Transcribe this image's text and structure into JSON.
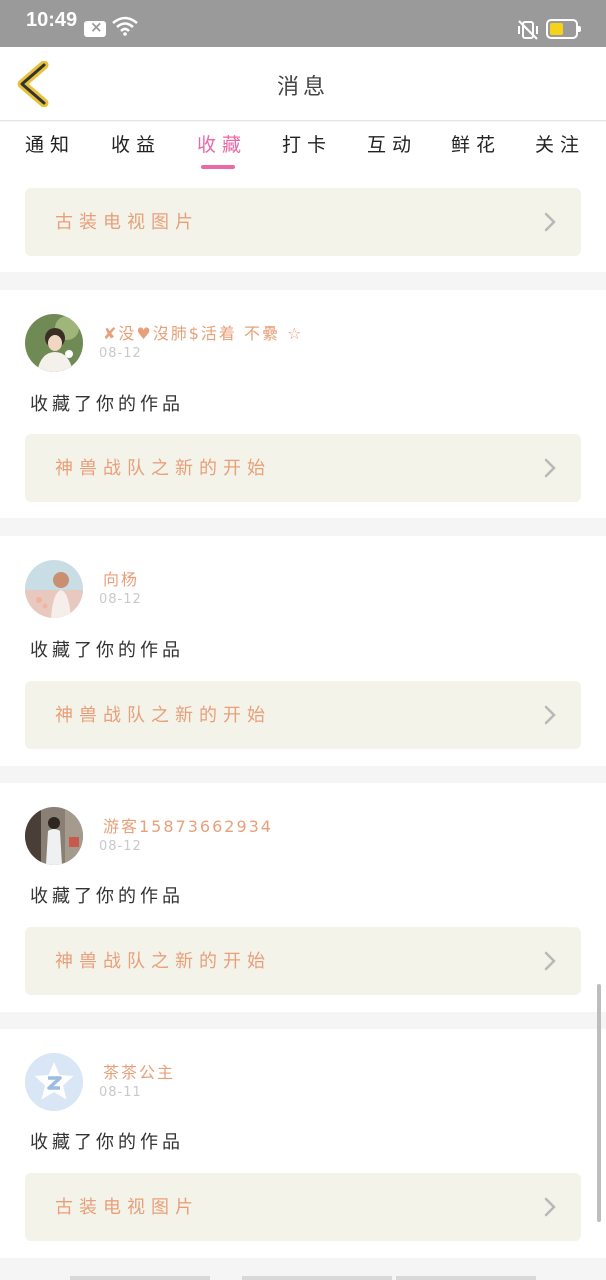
{
  "status_bar": {
    "time": "10:49"
  },
  "header": {
    "title": "消息"
  },
  "tabs": [
    {
      "label": "通知",
      "active": false
    },
    {
      "label": "收益",
      "active": false
    },
    {
      "label": "收藏",
      "active": true
    },
    {
      "label": "打卡",
      "active": false
    },
    {
      "label": "互动",
      "active": false
    },
    {
      "label": "鲜花",
      "active": false
    },
    {
      "label": "关注",
      "active": false
    }
  ],
  "top_work": {
    "title": "古装电视图片"
  },
  "items": [
    {
      "user": "✘没♥沒肺$活着 不纍 ☆",
      "date": "08-12",
      "action": "收藏了你的作品",
      "work": "神兽战队之新的开始"
    },
    {
      "user": "向杨",
      "date": "08-12",
      "action": "收藏了你的作品",
      "work": "神兽战队之新的开始"
    },
    {
      "user": "游客15873662934",
      "date": "08-12",
      "action": "收藏了你的作品",
      "work": "神兽战队之新的开始"
    },
    {
      "user": "茶茶公主",
      "date": "08-11",
      "action": "收藏了你的作品",
      "work": "古装电视图片"
    }
  ],
  "colors": {
    "accent": "#e86aa6",
    "username": "#e8a07a",
    "work_bg": "#f3f3ea",
    "status_bar": "#9a9a9a"
  }
}
